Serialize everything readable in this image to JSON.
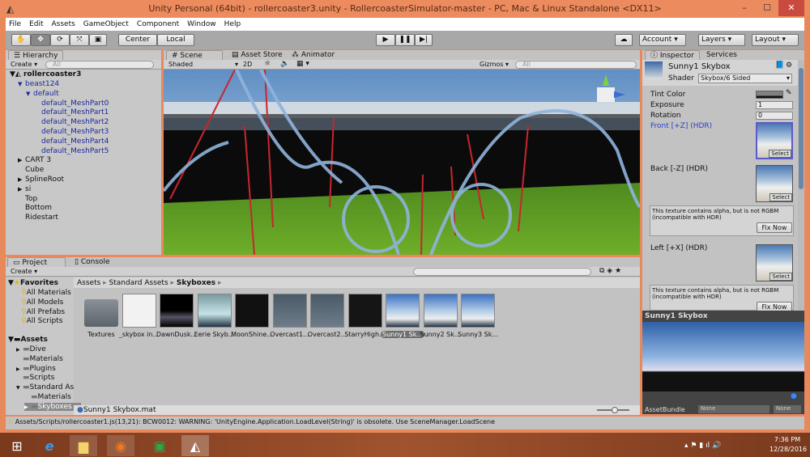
{
  "window": {
    "title": "Unity Personal (64bit) - rollercoaster3.unity - RollercoasterSimulator-master - PC, Mac & Linux Standalone <DX11>",
    "minimize": "–",
    "maximize": "☐",
    "close": "✕"
  },
  "menu": [
    "File",
    "Edit",
    "Assets",
    "GameObject",
    "Component",
    "Window",
    "Help"
  ],
  "toolbar": {
    "center": "Center",
    "local": "Local",
    "account": "Account",
    "layers": "Layers",
    "layout": "Layout"
  },
  "hierarchy": {
    "tab": "Hierarchy",
    "create": "Create",
    "search_placeholder": "All",
    "scene": "rollercoaster3",
    "items": [
      {
        "label": "beast124",
        "depth": 1,
        "arrow": "▼",
        "blue": true
      },
      {
        "label": "default",
        "depth": 2,
        "arrow": "▼",
        "blue": true
      },
      {
        "label": "default_MeshPart0",
        "depth": 3,
        "blue": true
      },
      {
        "label": "default_MeshPart1",
        "depth": 3,
        "blue": true
      },
      {
        "label": "default_MeshPart2",
        "depth": 3,
        "blue": true
      },
      {
        "label": "default_MeshPart3",
        "depth": 3,
        "blue": true
      },
      {
        "label": "default_MeshPart4",
        "depth": 3,
        "blue": true
      },
      {
        "label": "default_MeshPart5",
        "depth": 3,
        "blue": true
      },
      {
        "label": "CART 3",
        "depth": 1,
        "arrow": "▶"
      },
      {
        "label": "Cube",
        "depth": 1
      },
      {
        "label": "SplineRoot",
        "depth": 1,
        "arrow": "▶"
      },
      {
        "label": "si",
        "depth": 1,
        "arrow": "▶"
      },
      {
        "label": "Top",
        "depth": 1
      },
      {
        "label": "Bottom",
        "depth": 1
      },
      {
        "label": "Ridestart",
        "depth": 1
      }
    ]
  },
  "scene": {
    "tabs": [
      "Scene",
      "Asset Store",
      "Animator"
    ],
    "shading": "Shaded",
    "mode2d": "2D",
    "gizmos": "Gizmos",
    "search_placeholder": "All"
  },
  "inspector": {
    "tabs": [
      "Inspector",
      "Services"
    ],
    "name": "Sunny1 Skybox",
    "shader_label": "Shader",
    "shader": "Skybox/6 Sided",
    "tint_label": "Tint Color",
    "exposure_label": "Exposure",
    "exposure": "1",
    "rotation_label": "Rotation",
    "rotation": "0",
    "front": "Front [+Z]   (HDR)",
    "back": "Back [-Z]   (HDR)",
    "left": "Left [+X]   (HDR)",
    "select": "Select",
    "warning": "This texture contains alpha, but is not RGBM (incompatible with HDR)",
    "fix": "Fix Now"
  },
  "preview": {
    "title": "Sunny1 Skybox",
    "assetbundle_label": "AssetBundle",
    "bundle": "None",
    "variant": "None"
  },
  "project": {
    "tabs": [
      "Project",
      "Console"
    ],
    "create": "Create",
    "breadcrumb": [
      "Assets",
      "Standard Assets",
      "Skyboxes"
    ],
    "favorites": "Favorites",
    "fav_items": [
      "All Materials",
      "All Models",
      "All Prefabs",
      "All Scripts"
    ],
    "assets": "Assets",
    "folders": [
      {
        "label": "Dive",
        "depth": 1,
        "arrow": "▶"
      },
      {
        "label": "Materials",
        "depth": 1
      },
      {
        "label": "Plugins",
        "depth": 1,
        "arrow": "▶"
      },
      {
        "label": "Scripts",
        "depth": 1
      },
      {
        "label": "Standard As",
        "depth": 1,
        "arrow": "▼"
      },
      {
        "label": "Materials",
        "depth": 2
      },
      {
        "label": "Skyboxes",
        "depth": 2,
        "arrow": "▶",
        "selected": true
      }
    ],
    "files": [
      {
        "label": "Textures",
        "kind": "folder"
      },
      {
        "label": "_skybox in...",
        "kind": "doc"
      },
      {
        "label": "DawnDusk...",
        "kind": "dusk"
      },
      {
        "label": "Eerie Skyb...",
        "kind": "eerie"
      },
      {
        "label": "MoonShine...",
        "kind": "moon"
      },
      {
        "label": "Overcast1...",
        "kind": "over"
      },
      {
        "label": "Overcast2...",
        "kind": "over"
      },
      {
        "label": "StarryHigh...",
        "kind": "starry"
      },
      {
        "label": "Sunny1 Sk...",
        "kind": "sunny",
        "selected": true
      },
      {
        "label": "Sunny2 Sk...",
        "kind": "sunny"
      },
      {
        "label": "Sunny3 Sk...",
        "kind": "sunny"
      }
    ],
    "selected_file": "Sunny1 Skybox.mat"
  },
  "status": "Assets/Scripts/rollercoaster1.js(13,21): BCW0012: WARNING: 'UnityEngine.Application.LoadLevel(String)' is obsolete. Use SceneManager.LoadScene",
  "taskbar": {
    "time": "7:36 PM",
    "date": "12/28/2016"
  }
}
